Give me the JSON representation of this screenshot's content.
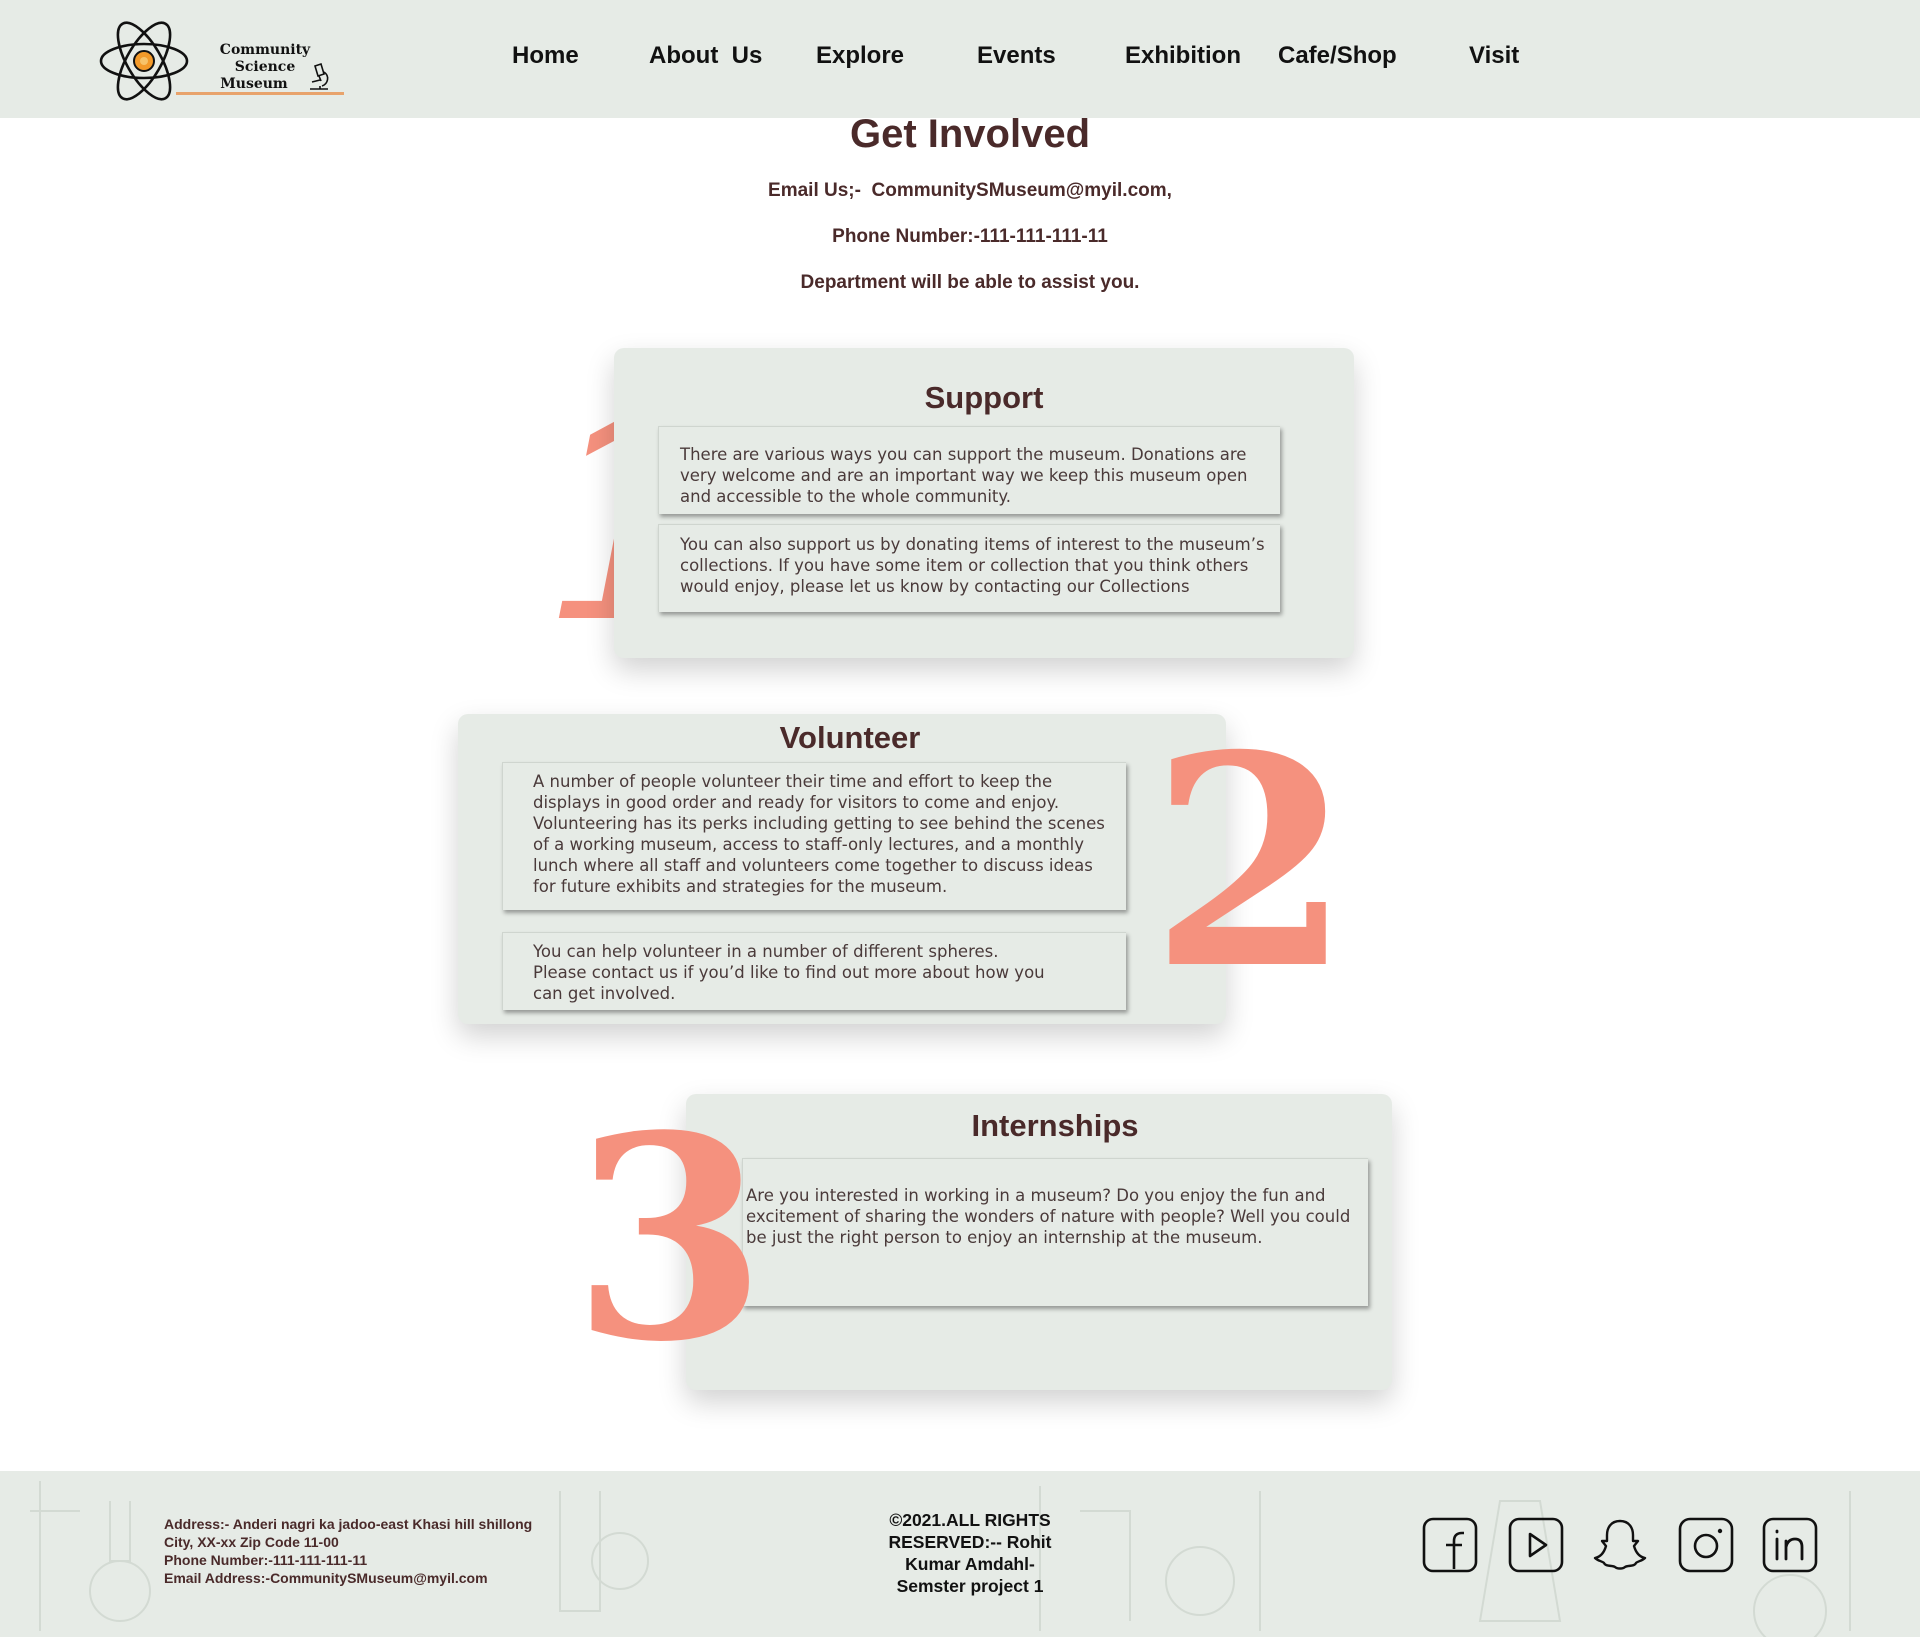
{
  "logo": {
    "line1": "Community Science",
    "line2": "Museum"
  },
  "nav": [
    {
      "label": "Home"
    },
    {
      "label": "About  Us"
    },
    {
      "label": "Explore"
    },
    {
      "label": "Events"
    },
    {
      "label": "Exhibition"
    },
    {
      "label": "Cafe/Shop"
    },
    {
      "label": "Visit"
    }
  ],
  "intro": {
    "title": "Get Involved",
    "email": "Email Us;-  CommunitySMuseum@myil.com,",
    "phone": "Phone Number:-111-111-111-11",
    "assist": "Department will be able to assist you."
  },
  "sections": {
    "support": {
      "number": "1",
      "title": "Support",
      "para1": "There are various ways you can support the museum. Donations are very welcome and are an important way we keep this museum open and accessible to the whole community.",
      "para2": "You can also support us by donating items of interest to the museum’s collections. If you have some item or collection that you think others would enjoy, please let us know by contacting our Collections"
    },
    "volunteer": {
      "number": "2",
      "title": "Volunteer",
      "para1": "A number of people volunteer their time and effort to keep the displays in good order and ready for visitors to come and enjoy. Volunteering has its perks including getting to see behind the scenes of a working museum, access to staff-only lectures, and a monthly lunch where all staff and volunteers come together to discuss ideas for future exhibits and strategies for the museum.",
      "para2": "You can help volunteer in a number of different spheres. Please contact us if you’d like to find out more about how you can get involved."
    },
    "internships": {
      "number": "3",
      "title": "Internships",
      "para1": "Are you interested in working in a museum? Do you enjoy the fun and excitement of sharing the wonders of nature with people? Well you could be just the right person to enjoy an internship at the museum."
    }
  },
  "footer": {
    "address": [
      "Address:- Anderi nagri ka jadoo-east Khasi hill shillong",
      "City, XX-xx Zip Code 11-00",
      "Phone Number:-111-111-111-11",
      "Email Address:-CommunitySMuseum@myil.com"
    ],
    "copyright": "©2021.ALL RIGHTS RESERVED:-- Rohit Kumar Amdahl- Semster project 1",
    "social": [
      "facebook-icon",
      "youtube-icon",
      "snapchat-icon",
      "instagram-icon",
      "linkedin-icon"
    ]
  },
  "colors": {
    "panel": "#e6ebe6",
    "heading": "#4a2a2a",
    "accent_number": "#f5917e",
    "logo_underline": "#e8a36c"
  }
}
